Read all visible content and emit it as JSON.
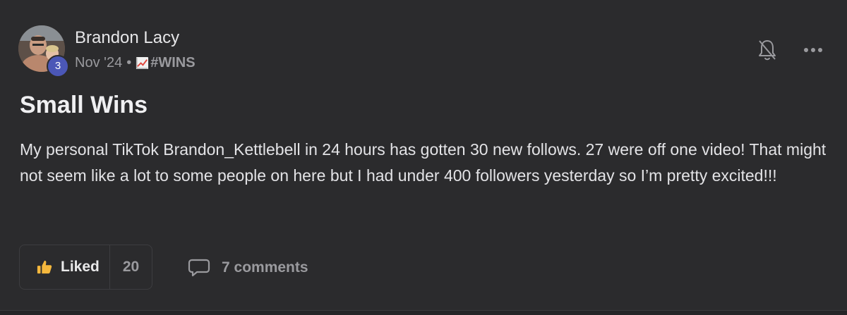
{
  "author": {
    "name": "Brandon Lacy",
    "level": "3"
  },
  "meta": {
    "date": "Nov '24",
    "separator": "•",
    "category": "#WINS",
    "category_icon": "chart-increasing-icon"
  },
  "post": {
    "title": "Small Wins",
    "body": "My personal TikTok Brandon_Kettlebell in 24 hours has gotten 30 new follows. 27 were off one video! That might not seem like a lot to some people on here but I had under 400 followers yesterday so I’m pretty excited!!!"
  },
  "actions": {
    "like_label": "Liked",
    "like_count": "20",
    "comments_label": "7 comments"
  },
  "colors": {
    "background": "#2b2b2d",
    "level_badge": "#4b57b7",
    "thumb": "#f5b83d",
    "muted_text": "#9a9a9e"
  }
}
